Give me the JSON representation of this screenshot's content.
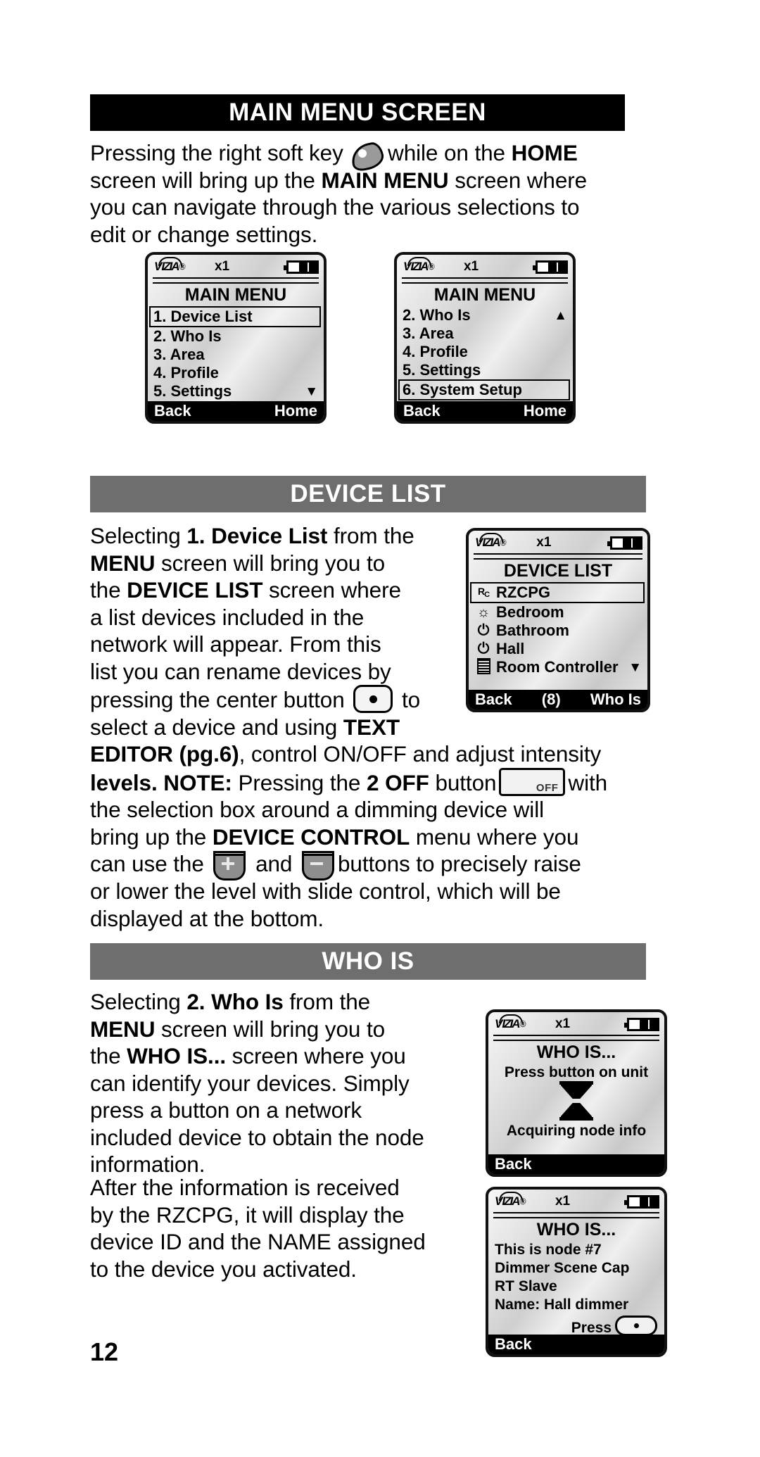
{
  "page_number": "12",
  "sections": [
    {
      "id": "main-menu-screen",
      "heading": "MAIN MENU SCREEN",
      "heading_style": "black"
    },
    {
      "id": "device-list",
      "heading": "DEVICE LIST",
      "heading_style": "gray"
    },
    {
      "id": "who-is",
      "heading": "WHO IS",
      "heading_style": "gray"
    }
  ],
  "body": {
    "main_menu_p1_a": "Pressing the right soft key",
    "main_menu_p1_b": "while on the",
    "main_menu_p1_home": "HOME",
    "main_menu_p2_a": "screen will bring up the",
    "main_menu_p2_b": "MAIN MENU",
    "main_menu_p2_c": "screen where",
    "main_menu_p3": "you can navigate through the various selections to",
    "main_menu_p4": "edit or change settings.",
    "device_list_l1_a": "Selecting",
    "device_list_l1_b": "1. Device List",
    "device_list_l1_c": "from the",
    "device_list_l2_a": "MENU",
    "device_list_l2_b": "screen will bring you to",
    "device_list_l3_a": "the",
    "device_list_l3_b": "DEVICE LIST",
    "device_list_l3_c": "screen where",
    "device_list_l4": "a list devices included in the",
    "device_list_l5": "network will appear. From this",
    "device_list_l6": "list you can rename devices by",
    "device_list_l7_a": "pressing the center button",
    "device_list_l7_b": "to",
    "device_list_l8_a": "select a device and using",
    "device_list_l8_b": "TEXT",
    "device_list_l9_a": "EDITOR (pg.6)",
    "device_list_l9_b": ", control ON/OFF and adjust intensity",
    "device_list_l10_a": "levels.",
    "device_list_l10_note": "NOTE:",
    "device_list_l10_b": "Pressing the",
    "device_list_l10_c": "2 OFF",
    "device_list_l10_d": "button",
    "device_list_l10_e": "with",
    "device_list_l11": "the selection box around a dimming device will",
    "device_list_l12_a": "bring up the",
    "device_list_l12_b": "DEVICE CONTROL",
    "device_list_l12_c": "menu where you",
    "device_list_l13_a": "can use the",
    "device_list_l13_b": "and",
    "device_list_l13_c": "buttons to precisely raise",
    "device_list_l14": "or lower the level with slide control, which will be",
    "device_list_l15": "displayed at the bottom.",
    "who_is_l1_a": "Selecting",
    "who_is_l1_b": "2. Who Is",
    "who_is_l1_c": "from the",
    "who_is_l2_a": "MENU",
    "who_is_l2_b": "screen will bring you to",
    "who_is_l3_a": "the",
    "who_is_l3_b": "WHO IS...",
    "who_is_l3_c": "screen where you",
    "who_is_l4": "can identify your devices. Simply",
    "who_is_l5": "press a button on a network",
    "who_is_l6": "included device to obtain the node",
    "who_is_l7": "information.",
    "who_is_l8": "After the information is received",
    "who_is_l9": "by the RZCPG, it will display the",
    "who_is_l10": "device ID and the NAME assigned",
    "who_is_l11": "to the device you activated."
  },
  "inline_controls": {
    "soft_key_icon": "soft-key-icon",
    "center_button_icon": "center-button-icon",
    "off_button_label": "OFF",
    "plus_button_icon": "plus-button-icon",
    "minus_button_icon": "minus-button-icon"
  },
  "lcd_common": {
    "brand": "VIZIA",
    "brand_mark": "®",
    "multiplier": "x1",
    "battery_segments": 3,
    "battery_filled": 2
  },
  "screens": [
    {
      "id": "main-menu-1",
      "title": "MAIN MENU",
      "rows": [
        {
          "label": "1. Device List",
          "selected": true,
          "icon": null,
          "arrow": null
        },
        {
          "label": "2. Who Is",
          "selected": false,
          "icon": null,
          "arrow": null
        },
        {
          "label": "3. Area",
          "selected": false,
          "icon": null,
          "arrow": null
        },
        {
          "label": "4. Profile",
          "selected": false,
          "icon": null,
          "arrow": null
        },
        {
          "label": "5. Settings",
          "selected": false,
          "icon": null,
          "arrow": "▼"
        }
      ],
      "footer": {
        "left": "Back",
        "middle": "",
        "right": "Home"
      }
    },
    {
      "id": "main-menu-2",
      "title": "MAIN MENU",
      "rows": [
        {
          "label": "2. Who Is",
          "selected": false,
          "icon": null,
          "arrow": "▲"
        },
        {
          "label": "3. Area",
          "selected": false,
          "icon": null,
          "arrow": null
        },
        {
          "label": "4. Profile",
          "selected": false,
          "icon": null,
          "arrow": null
        },
        {
          "label": "5. Settings",
          "selected": false,
          "icon": null,
          "arrow": null
        },
        {
          "label": "6. System Setup",
          "selected": true,
          "icon": null,
          "arrow": null
        }
      ],
      "footer": {
        "left": "Back",
        "middle": "",
        "right": "Home"
      }
    },
    {
      "id": "device-list-screen",
      "title": "DEVICE LIST",
      "rows": [
        {
          "label": "RZCPG",
          "selected": true,
          "icon": "rc-icon",
          "arrow": null
        },
        {
          "label": "Bedroom",
          "selected": false,
          "icon": "dimmer-icon",
          "arrow": null
        },
        {
          "label": "Bathroom",
          "selected": false,
          "icon": "power-icon",
          "arrow": null
        },
        {
          "label": "Hall",
          "selected": false,
          "icon": "power-icon",
          "arrow": null
        },
        {
          "label": "Room Controller",
          "selected": false,
          "icon": "controller-icon",
          "arrow": "▼"
        }
      ],
      "footer": {
        "left": "Back",
        "middle": "(8)",
        "right": "Who Is"
      }
    },
    {
      "id": "who-is-acquiring",
      "title": "WHO IS...",
      "lines_top": [
        "Press button on unit"
      ],
      "graphic": "hourglass-icon",
      "lines_bottom": [
        "Acquiring node info"
      ],
      "footer": {
        "left": "Back",
        "middle": "",
        "right": ""
      }
    },
    {
      "id": "who-is-result",
      "title": "WHO IS...",
      "lines": [
        "This is node #7",
        "Dimmer Scene Cap",
        "RT Slave",
        "Name: Hall dimmer"
      ],
      "press_label": "Press",
      "footer": {
        "left": "Back",
        "middle": "",
        "right": ""
      }
    }
  ],
  "colors": {
    "header_black": "#000000",
    "header_gray": "#6e6e6e",
    "text": "#000000",
    "page_bg": "#ffffff"
  }
}
